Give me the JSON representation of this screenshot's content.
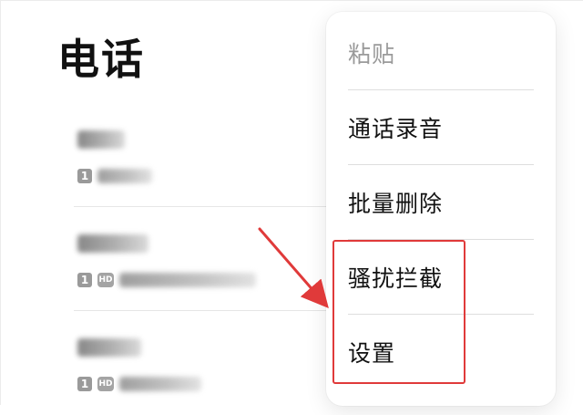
{
  "header": {
    "title": "电话"
  },
  "calls": [
    {
      "number_width": 52,
      "sub_badges": [
        "1"
      ],
      "location_width": 60
    },
    {
      "number_width": 78,
      "sub_badges": [
        "1",
        "HD"
      ],
      "location_width": 150
    },
    {
      "number_width": 70,
      "sub_badges": [
        "1",
        "HD"
      ],
      "location_width": 90
    }
  ],
  "menu": {
    "items": [
      {
        "label": "粘贴",
        "disabled": true
      },
      {
        "label": "通话录音",
        "disabled": false
      },
      {
        "label": "批量删除",
        "disabled": false
      },
      {
        "label": "骚扰拦截",
        "disabled": false
      },
      {
        "label": "设置",
        "disabled": false
      }
    ]
  },
  "colors": {
    "annotation": "#e03a3a"
  }
}
